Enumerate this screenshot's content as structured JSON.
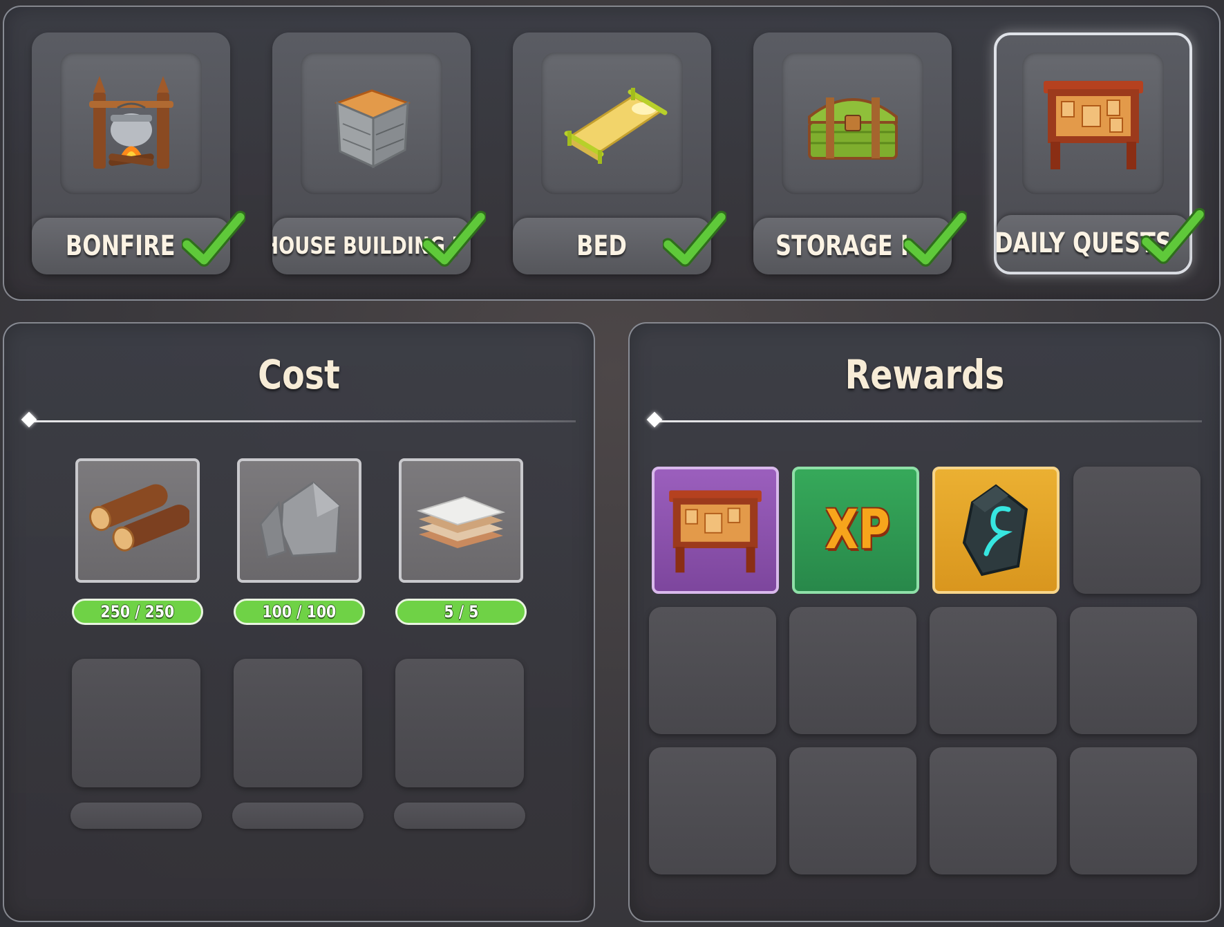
{
  "buildings": [
    {
      "label": "BONFIRE",
      "completed": true,
      "selected": false,
      "icon": "bonfire-icon"
    },
    {
      "label": "HOUSE BUILDING I",
      "completed": true,
      "selected": false,
      "icon": "house-block-icon"
    },
    {
      "label": "BED",
      "completed": true,
      "selected": false,
      "icon": "bed-icon"
    },
    {
      "label": "STORAGE I",
      "completed": true,
      "selected": false,
      "icon": "chest-icon"
    },
    {
      "label": "DAILY QUESTS",
      "completed": true,
      "selected": true,
      "icon": "quest-board-icon"
    }
  ],
  "cost": {
    "title": "Cost",
    "items": [
      {
        "icon": "wood-logs-icon",
        "progress": "250 / 250"
      },
      {
        "icon": "stone-icon",
        "progress": "100 / 100"
      },
      {
        "icon": "cloth-stack-icon",
        "progress": "5 / 5"
      }
    ]
  },
  "rewards": {
    "title": "Rewards",
    "items": [
      {
        "icon": "quest-board-icon",
        "frame_color": "#8a52a8"
      },
      {
        "icon": "xp-icon",
        "frame_color": "#2e9a4f",
        "text": "XP"
      },
      {
        "icon": "rune-stone-icon",
        "frame_color": "#e0a42a"
      }
    ]
  },
  "colors": {
    "check": "#5fc93a",
    "progress_fill": "#6fd246"
  }
}
